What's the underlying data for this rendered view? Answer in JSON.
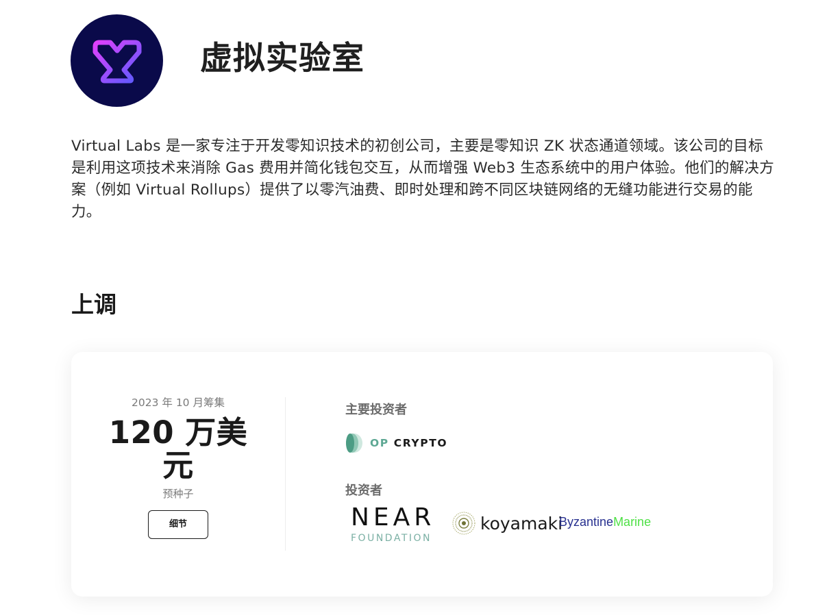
{
  "company": {
    "title": "虚拟实验室",
    "description": "Virtual Labs 是一家专注于开发零知识技术的初创公司，主要是零知识 ZK 状态通道领域。该公司的目标是利用这项技术来消除 Gas 费用并简化钱包交互，从而增强 Web3 生态系统中的用户体验。他们的解决方案（例如 Virtual Rollups）提供了以零汽油费、即时处理和跨不同区块链网络的无缝功能进行交易的能力。",
    "logo_icon": "virtual-labs-logo",
    "colors": {
      "logo_bg": "#0a0a4a",
      "logo_gradient_start": "#e040fb",
      "logo_gradient_end": "#5b5bff"
    }
  },
  "section": {
    "heading": "上调"
  },
  "funding_round": {
    "date": "2023 年 10 月筹集",
    "amount": "120 万美元",
    "stage": "预种子",
    "details_label": "细节"
  },
  "investors": {
    "lead_label": "主要投资者",
    "lead": [
      {
        "name_part1": "OP",
        "name_part2": "CRYPTO",
        "icon": "op-crypto-logo"
      }
    ],
    "others_label": "投资者",
    "others": [
      {
        "name": "NEAR",
        "sub": "FOUNDATION",
        "icon": "near-foundation-logo"
      },
      {
        "name": "koyamaki",
        "icon": "koyamaki-logo"
      },
      {
        "name_part1": "Byzantine",
        "name_part2": "Marine",
        "icon": "byzantine-marine-logo"
      }
    ]
  }
}
